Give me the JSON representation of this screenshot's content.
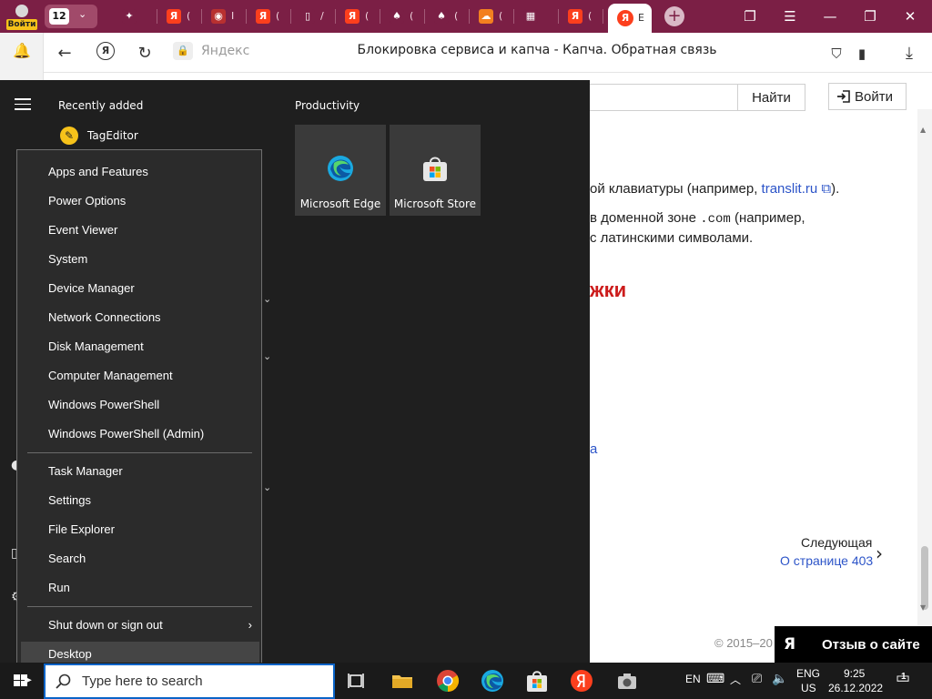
{
  "browser": {
    "login_badge": "Войти",
    "tab_count": "12",
    "tabs": [
      {
        "icon_name": "sparkle-tab-icon",
        "glyph": "✦",
        "color": "#7b1f45",
        "text": ""
      },
      {
        "icon_name": "yandex-tab-icon",
        "glyph": "Я",
        "color": "#fc3f1d",
        "text": "("
      },
      {
        "icon_name": "circle-tab-icon",
        "glyph": "◉",
        "color": "#b83030",
        "text": "I"
      },
      {
        "icon_name": "yandex-tab-icon",
        "glyph": "Я",
        "color": "#fc3f1d",
        "text": "("
      },
      {
        "icon_name": "document-tab-icon",
        "glyph": "▯",
        "color": "#7b1f45",
        "text": "/"
      },
      {
        "icon_name": "yandex-tab-icon",
        "glyph": "Я",
        "color": "#fc3f1d",
        "text": "("
      },
      {
        "icon_name": "mask-tab-icon",
        "glyph": "♠",
        "color": "#7b1f45",
        "text": "("
      },
      {
        "icon_name": "mask-tab-icon",
        "glyph": "♠",
        "color": "#7b1f45",
        "text": "("
      },
      {
        "icon_name": "cloud-tab-icon",
        "glyph": "☁",
        "color": "#f38020",
        "text": "("
      },
      {
        "icon_name": "microsoft-tab-icon",
        "glyph": "▦",
        "color": "#7b1f45",
        "text": ""
      },
      {
        "icon_name": "yandex-tab-icon",
        "glyph": "Я",
        "color": "#fc3f1d",
        "text": "("
      }
    ],
    "active_tab": {
      "glyph": "Я",
      "text": "E"
    },
    "address_yandex": "Яндекс",
    "page_title": "Блокировка сервиса и капча - Капча. Обратная связь",
    "lock_glyph": "🔒",
    "accent": "#7b1f45"
  },
  "page": {
    "find_label": "Найти",
    "login_label": "Войти",
    "para1_prefix": "ой клавиатуры (например, ",
    "para1_link": "translit.ru",
    "para1_suffix": ").",
    "para2_prefix": "в доменной зоне ",
    "para2_code": ".com",
    "para2_suffix": " (например,",
    "para3": "с латинскими символами.",
    "heading": "жки",
    "partial_link": "а",
    "next_label": "Следующая",
    "next_link": "О странице 403",
    "copyright": "© 2015–20",
    "feedback_logo": "Я",
    "feedback_label": "Отзыв о сайте"
  },
  "start_menu": {
    "recently_added": "Recently added",
    "recent_app": "TagEditor",
    "group_title": "Productivity",
    "tiles": [
      {
        "label": "Microsoft Edge",
        "icon": "edge-icon"
      },
      {
        "label": "Microsoft Store",
        "icon": "store-icon"
      }
    ]
  },
  "context_menu": {
    "group1": [
      "Apps and Features",
      "Power Options",
      "Event Viewer",
      "System",
      "Device Manager",
      "Network Connections",
      "Disk Management",
      "Computer Management",
      "Windows PowerShell",
      "Windows PowerShell (Admin)"
    ],
    "group2": [
      "Task Manager",
      "Settings",
      "File Explorer",
      "Search",
      "Run"
    ],
    "shutdown": "Shut down or sign out",
    "desktop": "Desktop"
  },
  "taskbar": {
    "search_placeholder": "Type here to search",
    "lang_short": "EN",
    "lang_line1": "ENG",
    "lang_line2": "US",
    "time": "9:25",
    "date": "26.12.2022",
    "notification_count": "1"
  }
}
